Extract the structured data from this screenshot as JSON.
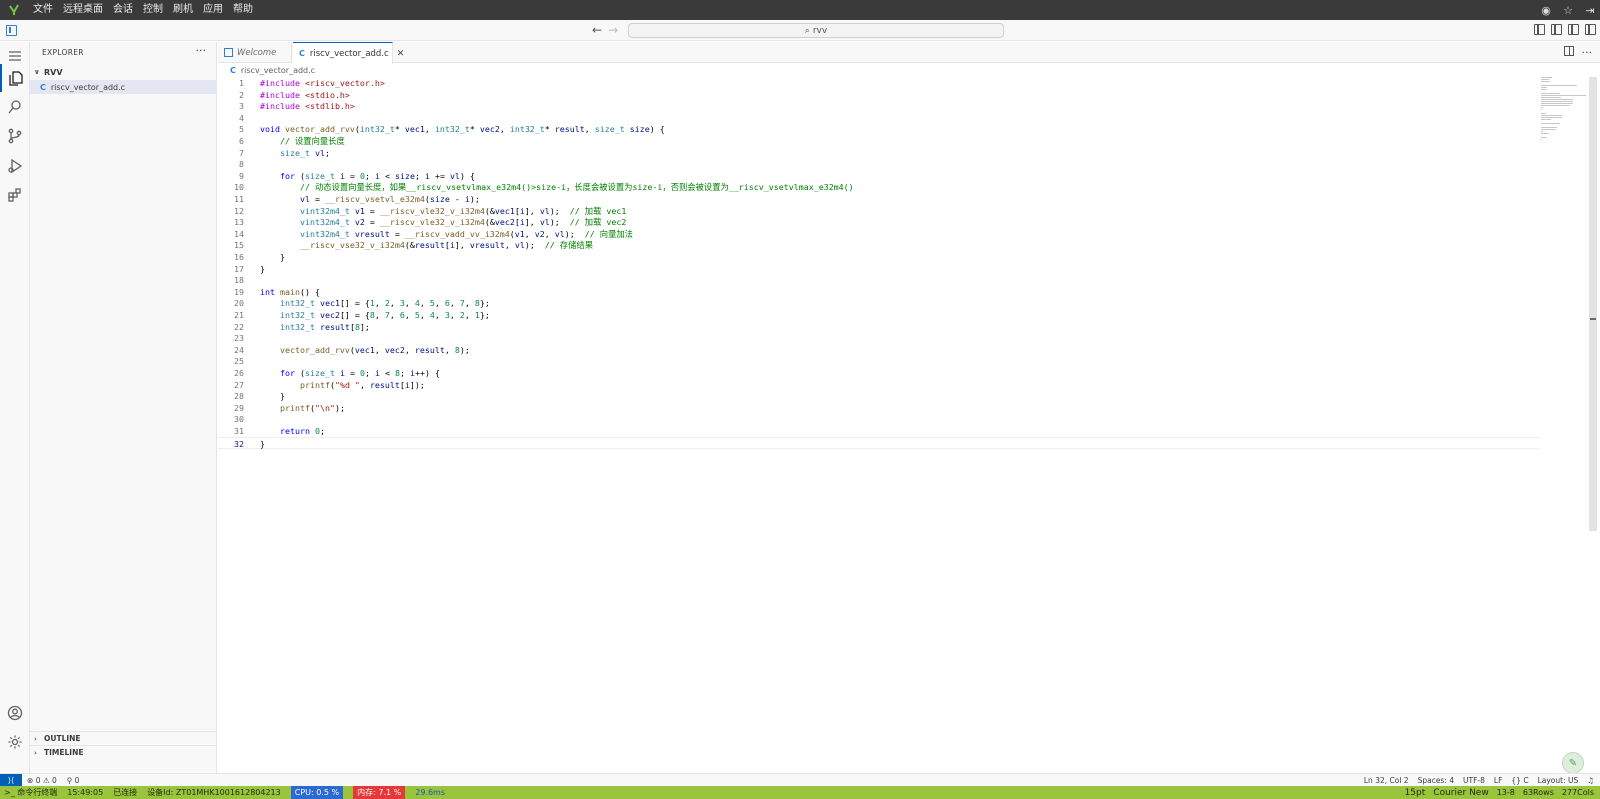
{
  "topbar": {
    "menu": [
      "文件",
      "远程桌面",
      "会话",
      "控制",
      "刷机",
      "应用",
      "帮助"
    ]
  },
  "titlebar": {
    "search_text": "rvv"
  },
  "sidebar": {
    "title": "EXPLORER",
    "folder": "RVV",
    "file_label": "riscv_vector_add.c",
    "sections": [
      "OUTLINE",
      "TIMELINE"
    ]
  },
  "tabs": [
    {
      "label": "Welcome"
    },
    {
      "label": "riscv_vector_add.c"
    }
  ],
  "breadcrumb": "riscv_vector_add.c",
  "code_lines": [
    "#include <riscv_vector.h>",
    "#include <stdio.h>",
    "#include <stdlib.h>",
    "",
    "void vector_add_rvv(int32_t* vec1, int32_t* vec2, int32_t* result, size_t size) {",
    "    // 设置向量长度",
    "    size_t vl;",
    "",
    "    for (size_t i = 0; i < size; i += vl) {",
    "        // 动态设置向量长度，如果__riscv_vsetvlmax_e32m4()>size-i，长度会被设置为size-i，否则会被设置为__riscv_vsetvlmax_e32m4()",
    "        vl = __riscv_vsetvl_e32m4(size - i);",
    "        vint32m4_t v1 = __riscv_vle32_v_i32m4(&vec1[i], vl);  // 加载 vec1",
    "        vint32m4_t v2 = __riscv_vle32_v_i32m4(&vec2[i], vl);  // 加载 vec2",
    "        vint32m4_t vresult = __riscv_vadd_vv_i32m4(v1, v2, vl);  // 向量加法",
    "        __riscv_vse32_v_i32m4(&result[i], vresult, vl);  // 存储结果",
    "    }",
    "}",
    "",
    "int main() {",
    "    int32_t vec1[] = {1, 2, 3, 4, 5, 6, 7, 8};",
    "    int32_t vec2[] = {8, 7, 6, 5, 4, 3, 2, 1};",
    "    int32_t result[8];",
    "",
    "    vector_add_rvv(vec1, vec2, result, 8);",
    "",
    "    for (size_t i = 0; i < 8; i++) {",
    "        printf(\"%d \", result[i]);",
    "    }",
    "    printf(\"\\n\");",
    "",
    "    return 0;",
    "}"
  ],
  "statusbar": {
    "errors": "0",
    "warnings": "0",
    "ports": "0",
    "position": "Ln 32, Col 2",
    "spaces": "Spaces: 4",
    "encoding": "UTF-8",
    "eol": "LF",
    "language": "C",
    "layout": "Layout: US"
  },
  "appbar": {
    "terminal": "命令行终端",
    "time": "15:49:05",
    "connection": "已连接",
    "device": "设备Id: ZT01MHK1001612804213",
    "cpu": "CPU: 0.5 %",
    "memory": "内存: 7.1 %",
    "latency": "29.6ms",
    "font_size": "15pt",
    "font_name": "Courier New",
    "rowcol": "13-8",
    "rows": "63Rows",
    "cols": "277Cols"
  },
  "colors": {
    "accent": "#005fb8",
    "appbar": "#9ac43b",
    "cpu_badge": "#2b6bd1",
    "mem_badge": "#e63838"
  }
}
